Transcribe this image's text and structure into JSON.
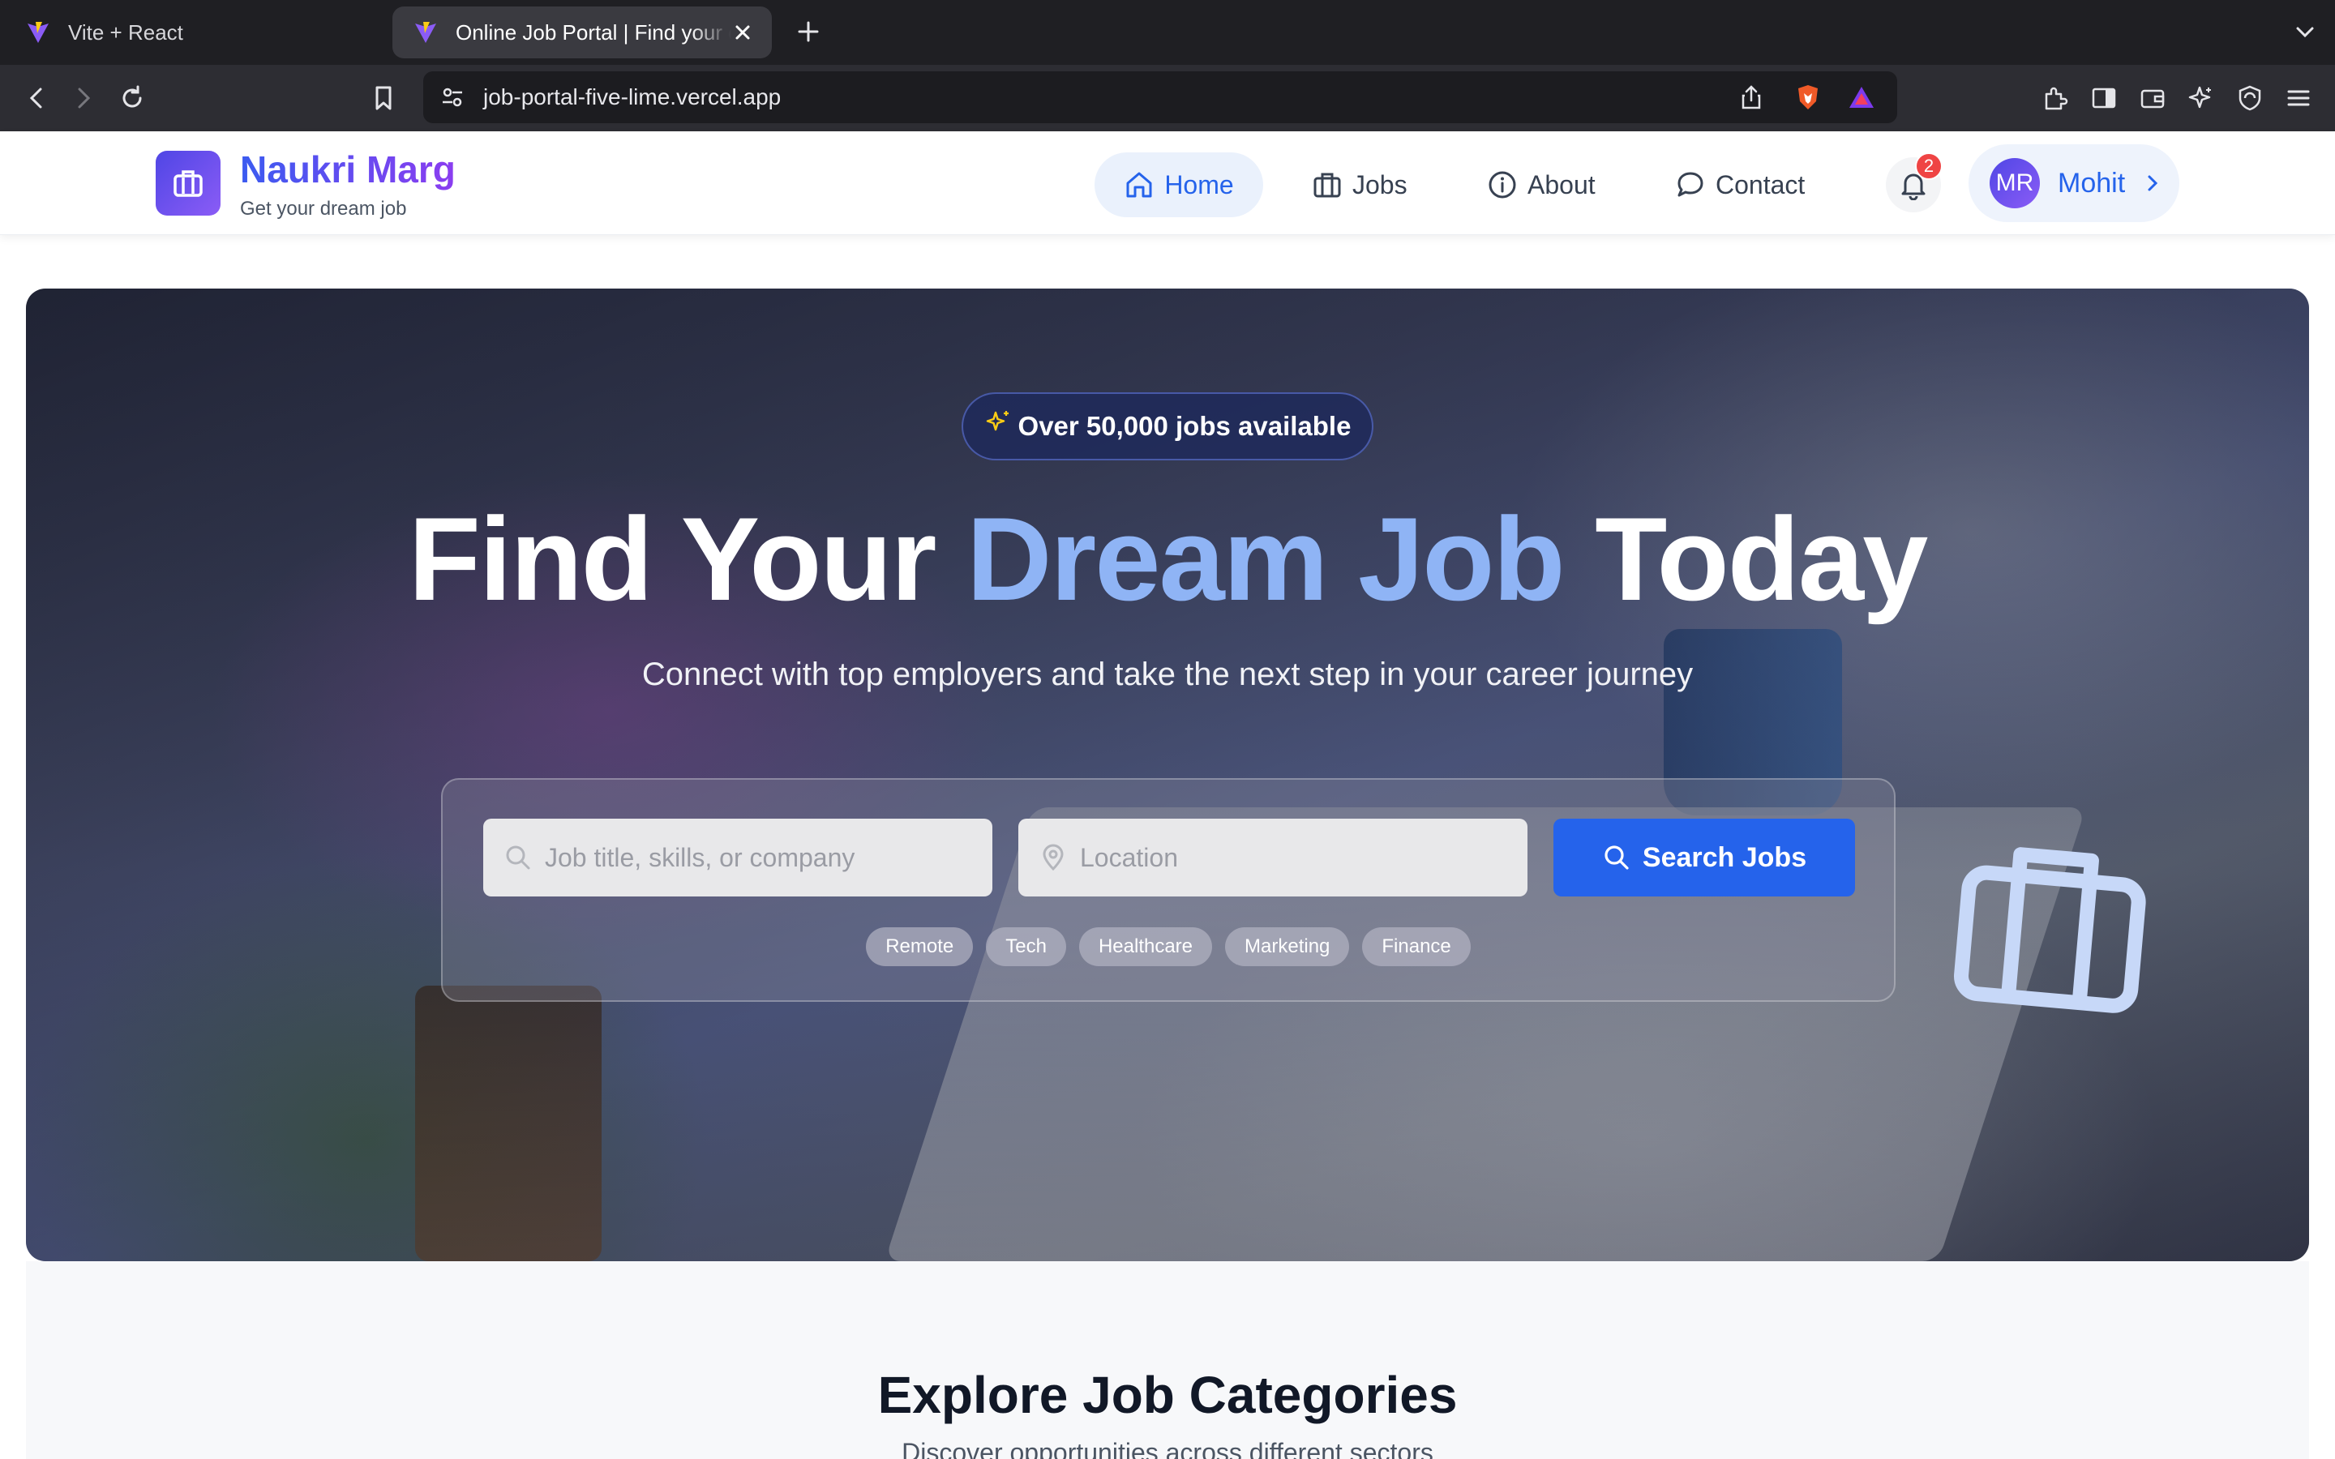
{
  "browser": {
    "tabs": [
      {
        "title": "Vite + React",
        "active": false
      },
      {
        "title": "Online Job Portal | Find your dream job",
        "active": true
      }
    ],
    "url": "job-portal-five-lime.vercel.app"
  },
  "header": {
    "brand": "Naukri Marg",
    "tagline": "Get your dream job",
    "nav": {
      "home": "Home",
      "jobs": "Jobs",
      "about": "About",
      "contact": "Contact"
    },
    "notifications_count": "2",
    "user": {
      "initials": "MR",
      "name": "Mohit"
    }
  },
  "hero": {
    "badge": "Over 50,000 jobs available",
    "title_part1": "Find Your ",
    "title_accent": "Dream Job",
    "title_part2": " Today",
    "subtitle": "Connect with top employers and take the next step in your career journey",
    "search": {
      "job_placeholder": "Job title, skills, or company",
      "location_placeholder": "Location",
      "button": "Search Jobs"
    },
    "tags": [
      "Remote",
      "Tech",
      "Healthcare",
      "Marketing",
      "Finance"
    ]
  },
  "categories": {
    "title": "Explore Job Categories",
    "subtitle": "Discover opportunities across different sectors"
  },
  "colors": {
    "brand_start": "#3b5bf0",
    "brand_end": "#8b3df0",
    "primary": "#2563eb",
    "accent_text": "#8fb4f5",
    "badge_bg": "#1c285c",
    "notification": "#ef4444"
  }
}
